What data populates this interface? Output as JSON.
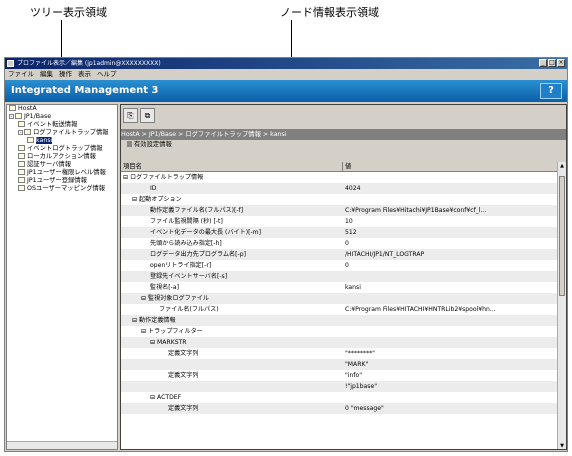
{
  "callouts": {
    "tree_area": "ツリー表示領域",
    "node_area": "ノード情報表示領域"
  },
  "window": {
    "title": "プロファイル表示／編集 (jp1admin@XXXXXXXXX)",
    "minimize": "_",
    "maximize": "□",
    "close": "×"
  },
  "menu": [
    "ファイル",
    "編集",
    "操作",
    "表示",
    "ヘルプ"
  ],
  "banner": {
    "title": "Integrated Management 3",
    "help": "?"
  },
  "tree": [
    {
      "label": "HostA",
      "level": 0,
      "expander": ""
    },
    {
      "label": "JP1/Base",
      "level": 0,
      "expander": "-"
    },
    {
      "label": "イベント転送情報",
      "level": 1,
      "expander": ""
    },
    {
      "label": "ログファイルトラップ情報",
      "level": 1,
      "expander": "-"
    },
    {
      "label": "kansi",
      "level": 2,
      "expander": "",
      "selected": true
    },
    {
      "label": "イベントログトラップ情報",
      "level": 1,
      "expander": ""
    },
    {
      "label": "ローカルアクション情報",
      "level": 1,
      "expander": ""
    },
    {
      "label": "認証サーバ情報",
      "level": 1,
      "expander": ""
    },
    {
      "label": "JP1ユーザー権限レベル情報",
      "level": 1,
      "expander": ""
    },
    {
      "label": "JP1ユーザー登録情報",
      "level": 1,
      "expander": ""
    },
    {
      "label": "OSユーザーマッピング情報",
      "level": 1,
      "expander": ""
    }
  ],
  "toolbar": {
    "btn1": "⎘",
    "btn2": "⧉"
  },
  "breadcrumb": "HostA > JP1/Base > ログファイルトラップ情報 > kansi",
  "section_label": "有効設定情報",
  "grid": {
    "col_name": "項目名",
    "col_value": "値",
    "rows": [
      {
        "name": "⊟ ログファイルトラップ情報",
        "indent": 0,
        "value": ""
      },
      {
        "name": "ID",
        "indent": 3,
        "value": "4024"
      },
      {
        "name": "⊟ 起動オプション",
        "indent": 1,
        "value": ""
      },
      {
        "name": "動作定義ファイル名(フルパス)[-f]",
        "indent": 3,
        "value": "C:¥Program Files¥Hitachi¥JP1Base¥conf¥cf_l..."
      },
      {
        "name": "ファイル監視間隔 (秒) [-t]",
        "indent": 3,
        "value": "10"
      },
      {
        "name": "イベント化データの最大長 (バイト)[-m]",
        "indent": 3,
        "value": "512"
      },
      {
        "name": "先頭から読み込み指定[-h]",
        "indent": 3,
        "value": "0"
      },
      {
        "name": "ログデータ出力先プログラム名[-p]",
        "indent": 3,
        "value": "/HITACHI/JP1/NT_LOGTRAP"
      },
      {
        "name": "openリトライ指定[-r]",
        "indent": 3,
        "value": "0"
      },
      {
        "name": "登録先イベントサーバ名[-s]",
        "indent": 3,
        "value": ""
      },
      {
        "name": "監視名[-a]",
        "indent": 3,
        "value": "kansi"
      },
      {
        "name": "⊟ 監視対象ログファイル",
        "indent": 2,
        "value": ""
      },
      {
        "name": "ファイル名(フルパス)",
        "indent": 4,
        "value": "C:¥Program Files¥HITACHI¥HNTRLib2¥spool¥hn..."
      },
      {
        "name": "⊟ 動作定義情報",
        "indent": 1,
        "value": ""
      },
      {
        "name": "⊟ トラップフィルター",
        "indent": 2,
        "value": ""
      },
      {
        "name": "⊟ MARKSTR",
        "indent": 3,
        "value": ""
      },
      {
        "name": "定義文字列",
        "indent": 5,
        "value": "\"********\""
      },
      {
        "name": "",
        "indent": 5,
        "value": "\"MARK\""
      },
      {
        "name": "定義文字列",
        "indent": 5,
        "value": "\"info\""
      },
      {
        "name": "",
        "indent": 5,
        "value": "!\"jp1base\""
      },
      {
        "name": "⊟ ACTDEF",
        "indent": 3,
        "value": ""
      },
      {
        "name": "定義文字列",
        "indent": 5,
        "value": "0        \"message\""
      }
    ]
  }
}
